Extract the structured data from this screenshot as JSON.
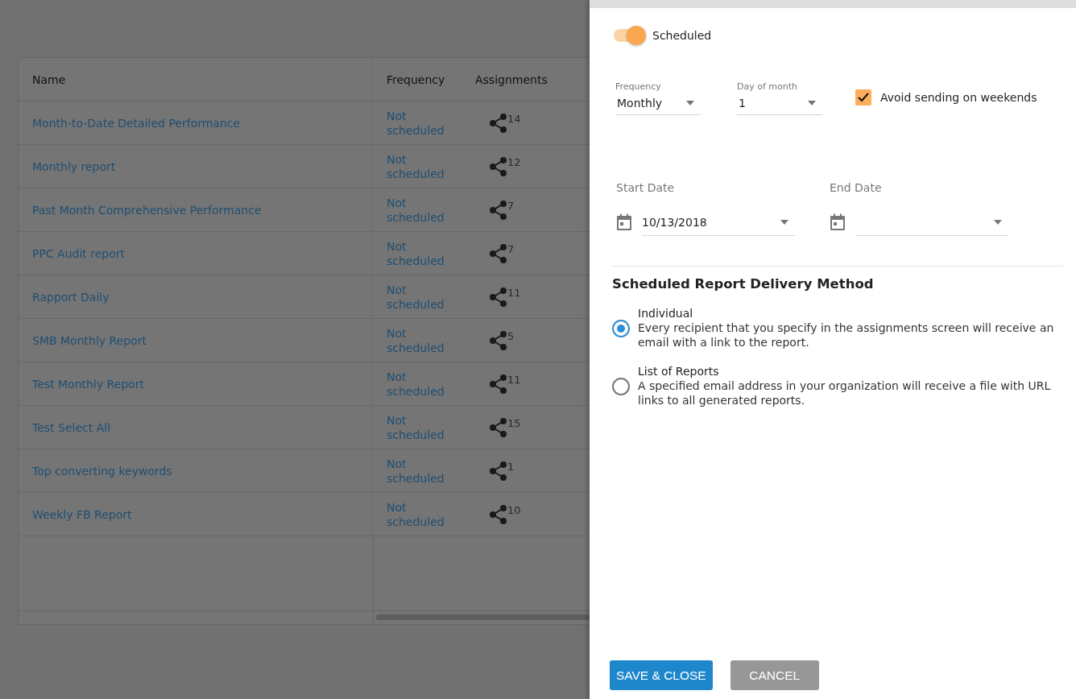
{
  "table": {
    "columns": [
      "Name",
      "Frequency",
      "Assignments"
    ],
    "rows": [
      {
        "name": "Month-to-Date Detailed Performance",
        "frequency": "Not scheduled",
        "assignments": "14"
      },
      {
        "name": "Monthly report",
        "frequency": "Not scheduled",
        "assignments": "12"
      },
      {
        "name": "Past Month Comprehensive Performance",
        "frequency": "Not scheduled",
        "assignments": "7"
      },
      {
        "name": "PPC Audit report",
        "frequency": "Not scheduled",
        "assignments": "7"
      },
      {
        "name": "Rapport Daily",
        "frequency": "Not scheduled",
        "assignments": "11"
      },
      {
        "name": "SMB Monthly Report",
        "frequency": "Not scheduled",
        "assignments": "5"
      },
      {
        "name": "Test Monthly Report",
        "frequency": "Not scheduled",
        "assignments": "11"
      },
      {
        "name": "Test Select All",
        "frequency": "Not scheduled",
        "assignments": "15"
      },
      {
        "name": "Top converting keywords",
        "frequency": "Not scheduled",
        "assignments": "1"
      },
      {
        "name": "Weekly FB Report",
        "frequency": "Not scheduled",
        "assignments": "10"
      }
    ]
  },
  "drawer": {
    "scheduled": {
      "label": "Scheduled",
      "on": true
    },
    "frequency": {
      "label": "Frequency",
      "value": "Monthly"
    },
    "day_of_month": {
      "label": "Day of month",
      "value": "1"
    },
    "avoid_weekends": {
      "label": "Avoid sending on weekends",
      "checked": true
    },
    "start_date": {
      "label": "Start Date",
      "value": "10/13/2018"
    },
    "end_date": {
      "label": "End Date"
    },
    "delivery": {
      "title": "Scheduled Report Delivery Method",
      "options": [
        {
          "title": "Individual",
          "description": "Every recipient that you specify in the assignments screen will receive an email with a link to the report.",
          "selected": true
        },
        {
          "title": "List of Reports",
          "description": "A specified email address in your organization will receive a file with URL links to all generated reports.",
          "selected": false
        }
      ]
    },
    "buttons": [
      {
        "label": "SAVE & CLOSE",
        "kind": "primary"
      },
      {
        "label": "CANCEL",
        "kind": "secondary"
      }
    ]
  }
}
